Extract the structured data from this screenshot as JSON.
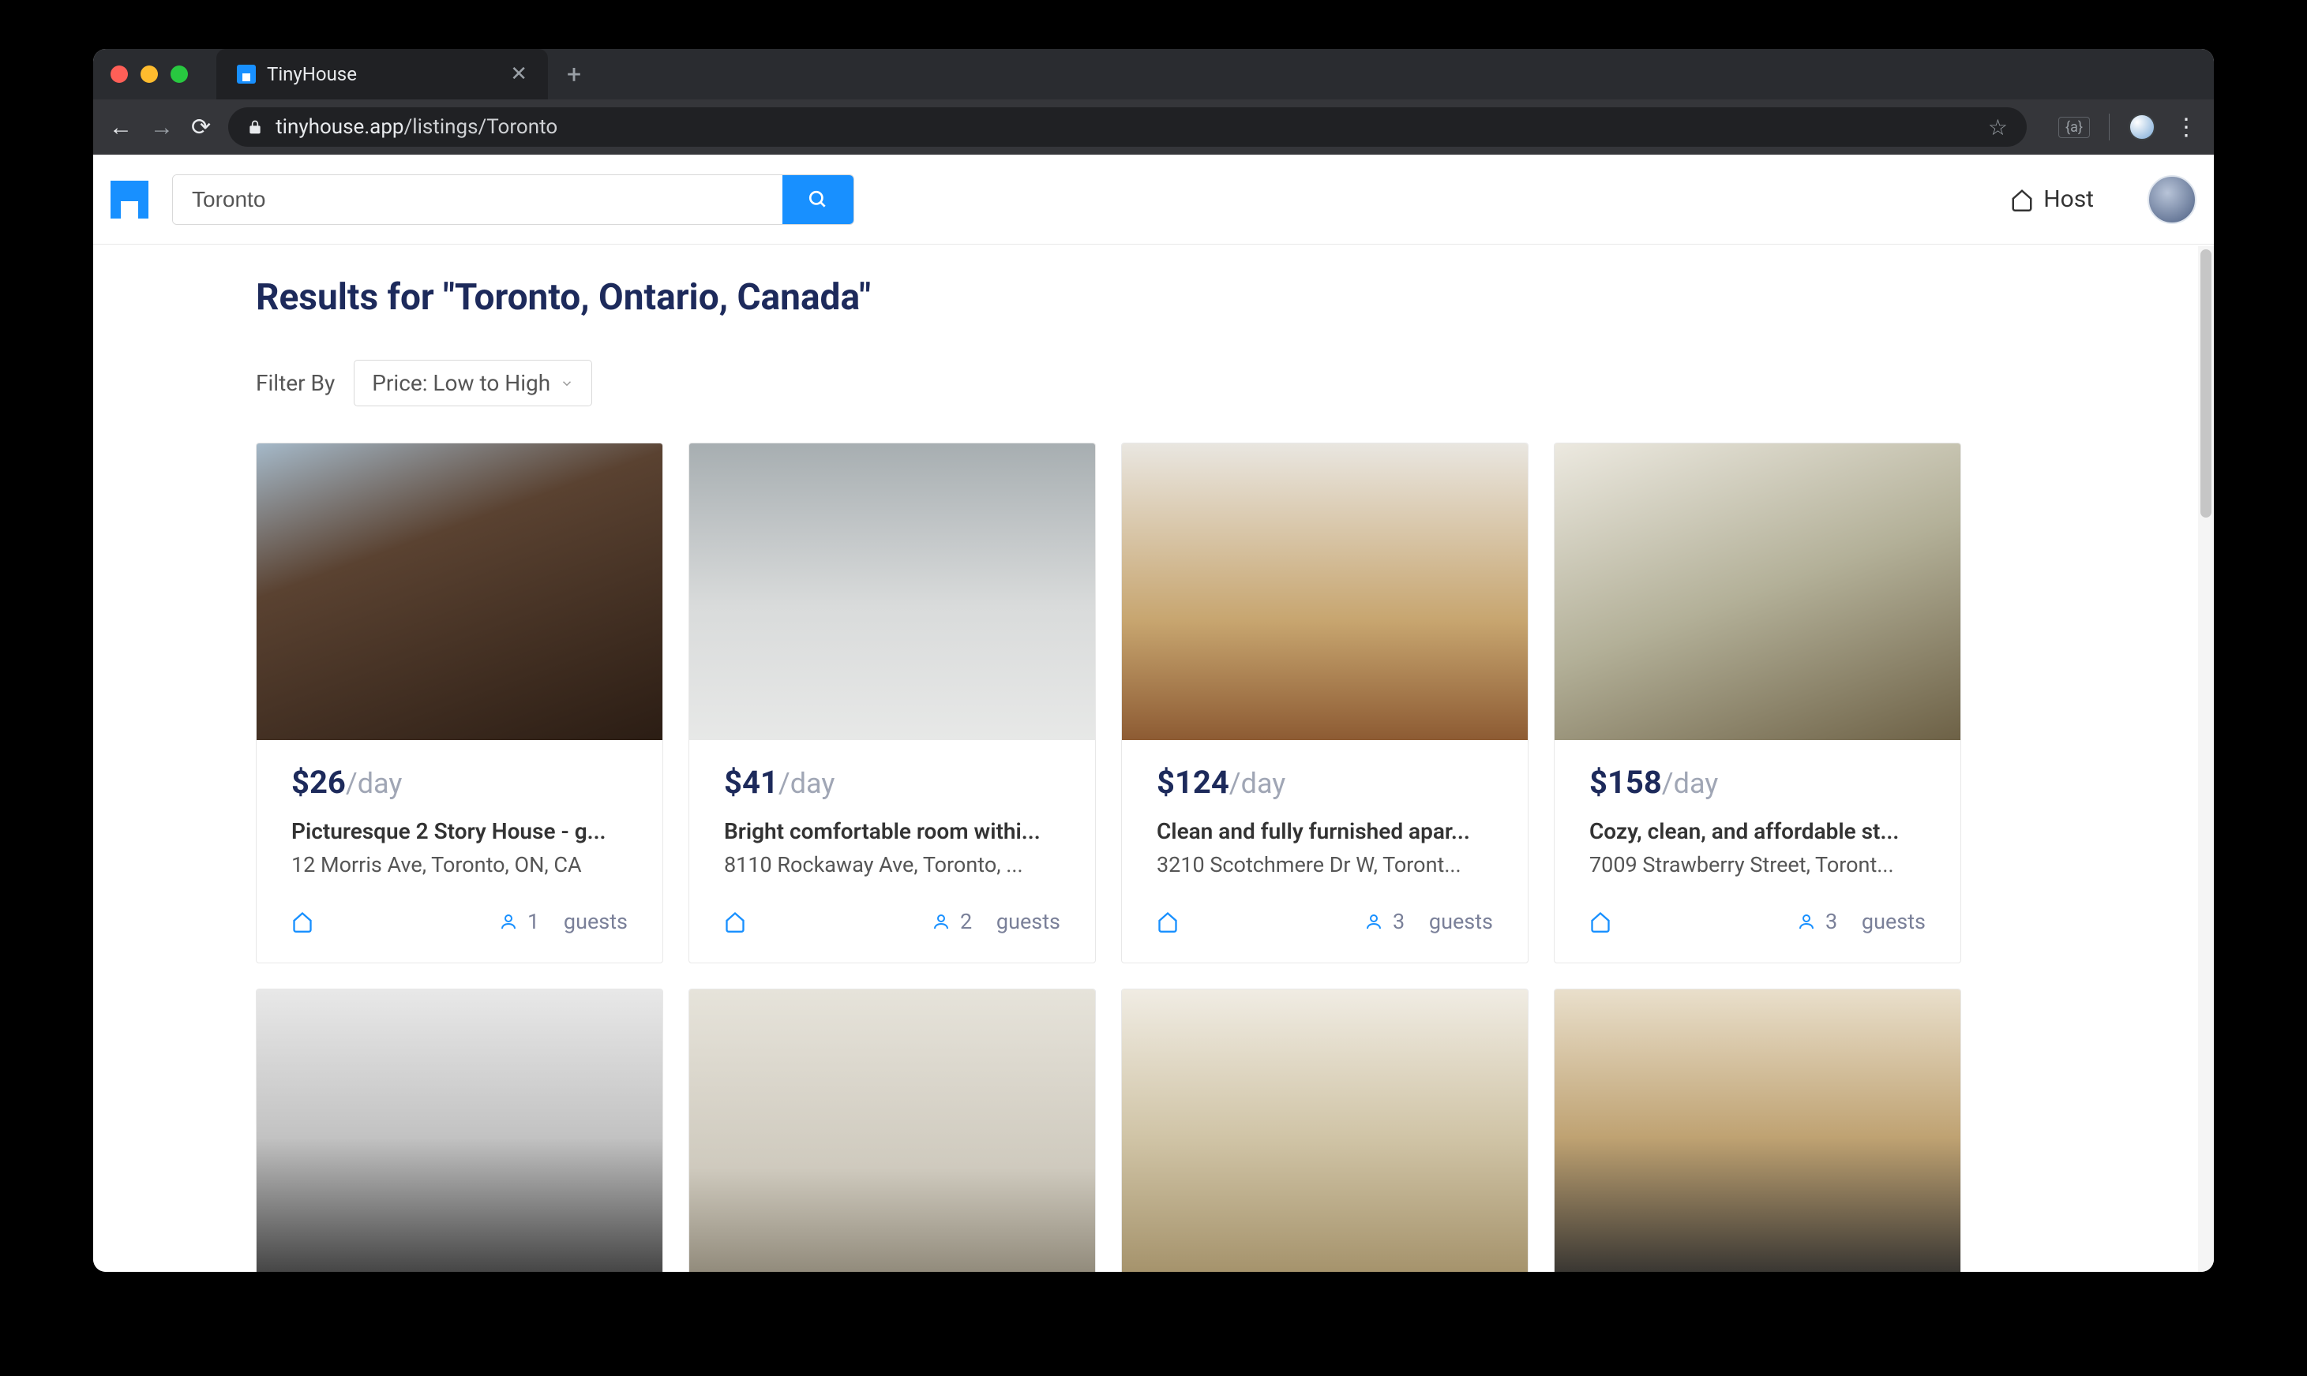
{
  "browser": {
    "tab_title": "TinyHouse",
    "url_display": "tinyhouse.app/listings/Toronto",
    "url_domain": "tinyhouse.app",
    "url_path": "/listings/Toronto",
    "ext_chip": "{a}"
  },
  "header": {
    "search_value": "Toronto",
    "host_label": "Host"
  },
  "results": {
    "title": "Results for \"Toronto, Ontario, Canada\"",
    "filter_label": "Filter By",
    "filter_value": "Price: Low to High"
  },
  "price_suffix": "/day",
  "guests_word": "guests",
  "listings": [
    {
      "price": "$26",
      "title": "Picturesque 2 Story House - g...",
      "address": "12 Morris Ave, Toronto, ON, CA",
      "guests": "1"
    },
    {
      "price": "$41",
      "title": "Bright comfortable room withi...",
      "address": "8110 Rockaway Ave, Toronto, ...",
      "guests": "2"
    },
    {
      "price": "$124",
      "title": "Clean and fully furnished apar...",
      "address": "3210 Scotchmere Dr W, Toront...",
      "guests": "3"
    },
    {
      "price": "$158",
      "title": "Cozy, clean, and affordable st...",
      "address": "7009 Strawberry Street, Toront...",
      "guests": "3"
    }
  ]
}
